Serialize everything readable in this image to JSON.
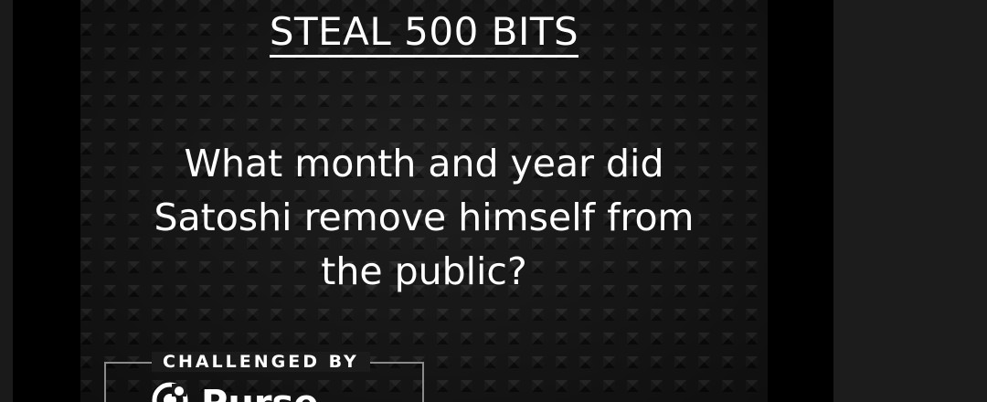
{
  "slide": {
    "heading": "STEAL 500 BITS",
    "question": "What month and year did\nSatoshi remove himself from\nthe public?",
    "challenge_label": "CHALLENGED BY",
    "brand_name": "Purse",
    "brand_icon": "purse-logo-icon"
  },
  "colors": {
    "background": "#000000",
    "slide_base": "#1b1b1b",
    "text": "#ffffff",
    "right_panel": "#1c1c1c"
  }
}
